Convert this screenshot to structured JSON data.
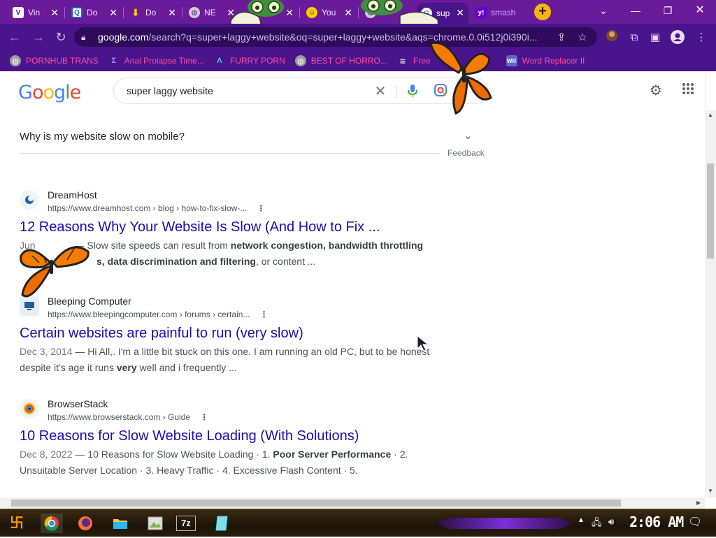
{
  "browser": {
    "tabs": [
      {
        "label": "Vin",
        "favicon": "vimeo-icon",
        "color": "#ffffff",
        "fg": "#4a148c"
      },
      {
        "label": "Do",
        "favicon": "download-q-icon",
        "color": "#ffffff",
        "fg": "#1565c0"
      },
      {
        "label": "Do",
        "favicon": "download-arrow-icon",
        "color": "#ffcc00",
        "fg": "#4a148c"
      },
      {
        "label": "NE",
        "favicon": "globe-icon",
        "color": "#cfcfcf",
        "fg": "#4a148c"
      },
      {
        "label": "",
        "favicon": "frog-icon",
        "color": "#8bc34a",
        "fg": "#1b5e20"
      },
      {
        "label": "You",
        "favicon": "smiley-icon",
        "color": "#ffcc00",
        "fg": "#4a148c"
      },
      {
        "label": "",
        "favicon": "globe-icon",
        "color": "#cfcfcf",
        "fg": "#4a148c"
      },
      {
        "label": "sup",
        "favicon": "google-icon",
        "color": "#ffffff",
        "fg": "#4285f4"
      },
      {
        "label": "smash",
        "favicon": "yahoo-icon",
        "color": "#6001d2",
        "fg": "#ffffff"
      }
    ],
    "url_host": "google.com",
    "url_rest": "/search?q=super+laggy+website&oq=super+laggy+website&aqs=chrome.0.0i512j0i390i...",
    "bookmarks": [
      {
        "label": "PORNHUB TRANS",
        "icon": "globe-icon",
        "icon_color": "#9e9e9e"
      },
      {
        "label": "Anal Prolapse Time...",
        "icon": "bracket-icon",
        "icon_color": "#7b1fa2"
      },
      {
        "label": "FURRY PORN",
        "icon": "lambda-icon",
        "icon_color": "#00897b"
      },
      {
        "label": "BEST OF HORRO...",
        "icon": "globe-icon",
        "icon_color": "#9e9e9e"
      },
      {
        "label": "Free",
        "icon": "stack-icon",
        "icon_color": "#607d8b"
      },
      {
        "label": "Word Replacer II",
        "icon": "wr-icon",
        "icon_color": "#5c6bc0"
      }
    ]
  },
  "google": {
    "logo": "Google",
    "query": "super laggy website",
    "paa_question": "Why is my website slow on mobile?",
    "feedback": "Feedback"
  },
  "results": [
    {
      "site": "DreamHost",
      "url": "https://www.dreamhost.com › blog › how-to-fix-slow-...",
      "title": "12 Reasons Why Your Website Is Slow (And How to Fix ...",
      "date": "Jun",
      "snippet_a": "— Slow site speeds can result from ",
      "bold_a": "network congestion, bandwidth throttling",
      "line2_pre": "",
      "bold_b": "s, data discrimination and filtering",
      "snippet_b": ", or content ..."
    },
    {
      "site": "Bleeping Computer",
      "url": "https://www.bleepingcomputer.com › forums › certain...",
      "title": "Certain websites are painful to run (very slow)",
      "date": "Dec 3, 2014",
      "snippet_a": " — Hi All,. I'm a little bit stuck on this one. I am running an old PC, but to be honest despite it's age it runs ",
      "bold_a": "very",
      "snippet_b": " well and i frequently ..."
    },
    {
      "site": "BrowserStack",
      "url": "https://www.browserstack.com › Guide",
      "title": "10 Reasons for Slow Website Loading (With Solutions)",
      "date": "Dec 8, 2022",
      "snippet_a": " — 10 Reasons for Slow Website Loading · 1. ",
      "bold_a": "Poor Server Performance",
      "snippet_b": " · 2. Unsuitable Server Location · 3. Heavy Traffic · 4. Excessive Flash Content · 5."
    }
  ],
  "taskbar": {
    "clock": "2:06 AM",
    "apps": [
      "start-icon",
      "chrome-icon",
      "firefox-icon",
      "folder-icon",
      "image-viewer-icon",
      "7zip-icon",
      "notepad-icon"
    ],
    "sevenzip": "7z"
  },
  "colors": {
    "chrome_frame": "#4a148c",
    "link": "#1a0dab",
    "bookmark_text": "#ff4fa0"
  }
}
